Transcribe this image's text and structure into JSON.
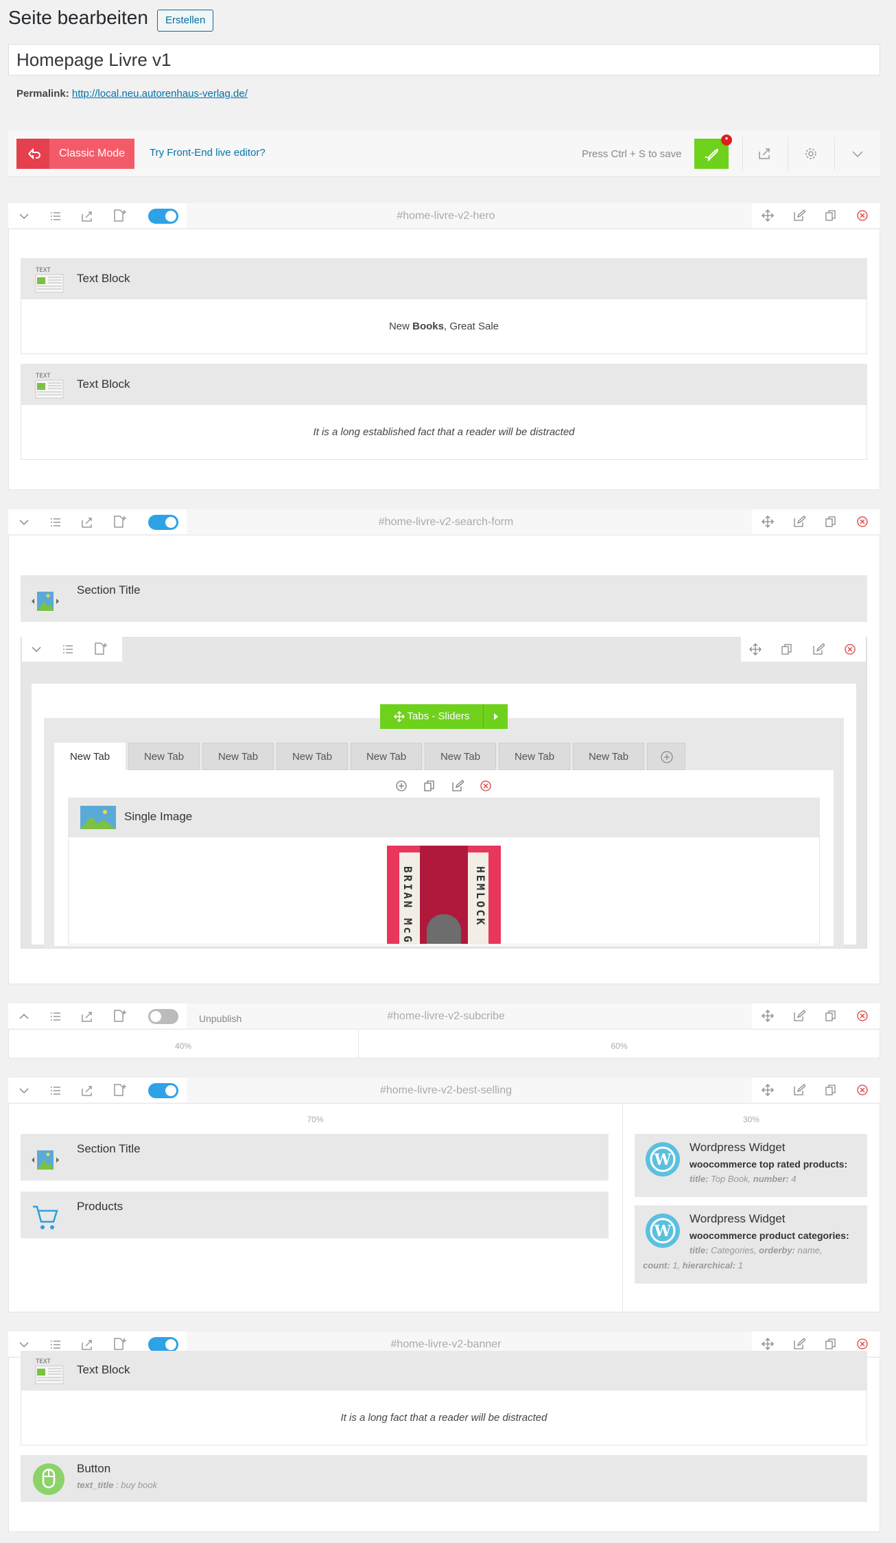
{
  "header": {
    "title": "Seite bearbeiten",
    "add_new": "Erstellen",
    "post_title": "Homepage Livre v1",
    "permalink_label": "Permalink:",
    "permalink_url": "http://local.neu.autorenhaus-verlag.de/"
  },
  "toolbar": {
    "classic_mode": "Classic Mode",
    "frontend_link": "Try Front-End live editor?",
    "save_hint": "Press Ctrl + S to save",
    "badge": "*"
  },
  "rows": {
    "hero": {
      "id": "#home-livre-v2-hero",
      "blocks": [
        {
          "title": "Text Block",
          "content_pre": "New ",
          "content_bold": "Books",
          "content_post": ", Great Sale"
        },
        {
          "title": "Text Block",
          "content": "It is a long established fact that a reader will be distracted"
        }
      ]
    },
    "search": {
      "id": "#home-livre-v2-search-form",
      "section_title": "Section Title",
      "tabs_label": "Tabs - Sliders",
      "tabs": [
        "New Tab",
        "New Tab",
        "New Tab",
        "New Tab",
        "New Tab",
        "New Tab",
        "New Tab",
        "New Tab"
      ],
      "single_image": "Single Image",
      "book_left": "BRIAN McG",
      "book_right": "HEMLOCK"
    },
    "subscribe": {
      "id": "#home-livre-v2-subcribe",
      "status": "Unpublish",
      "col1": "40%",
      "col2": "60%"
    },
    "best_selling": {
      "id": "#home-livre-v2-best-selling",
      "col1": "70%",
      "col2": "30%",
      "section_title": "Section Title",
      "products": "Products",
      "widget1": {
        "title": "Wordpress Widget",
        "sub": "woocommerce top rated products:",
        "k1": "title:",
        "v1": " Top Book, ",
        "k2": "number:",
        "v2": " 4"
      },
      "widget2": {
        "title": "Wordpress Widget",
        "sub": "woocommerce product categories:",
        "k1": "title:",
        "v1": " Categories, ",
        "k2": "orderby:",
        "v2": " name,",
        "k3": "count:",
        "v3": " 1, ",
        "k4": "hierarchical:",
        "v4": " 1"
      }
    },
    "banner": {
      "id": "#home-livre-v2-banner",
      "text_block": "Text Block",
      "text_content": "It is a long fact that a reader will be distracted",
      "button_title": "Button",
      "button_param_key": "text_title",
      "button_param_val": " : buy book"
    }
  }
}
